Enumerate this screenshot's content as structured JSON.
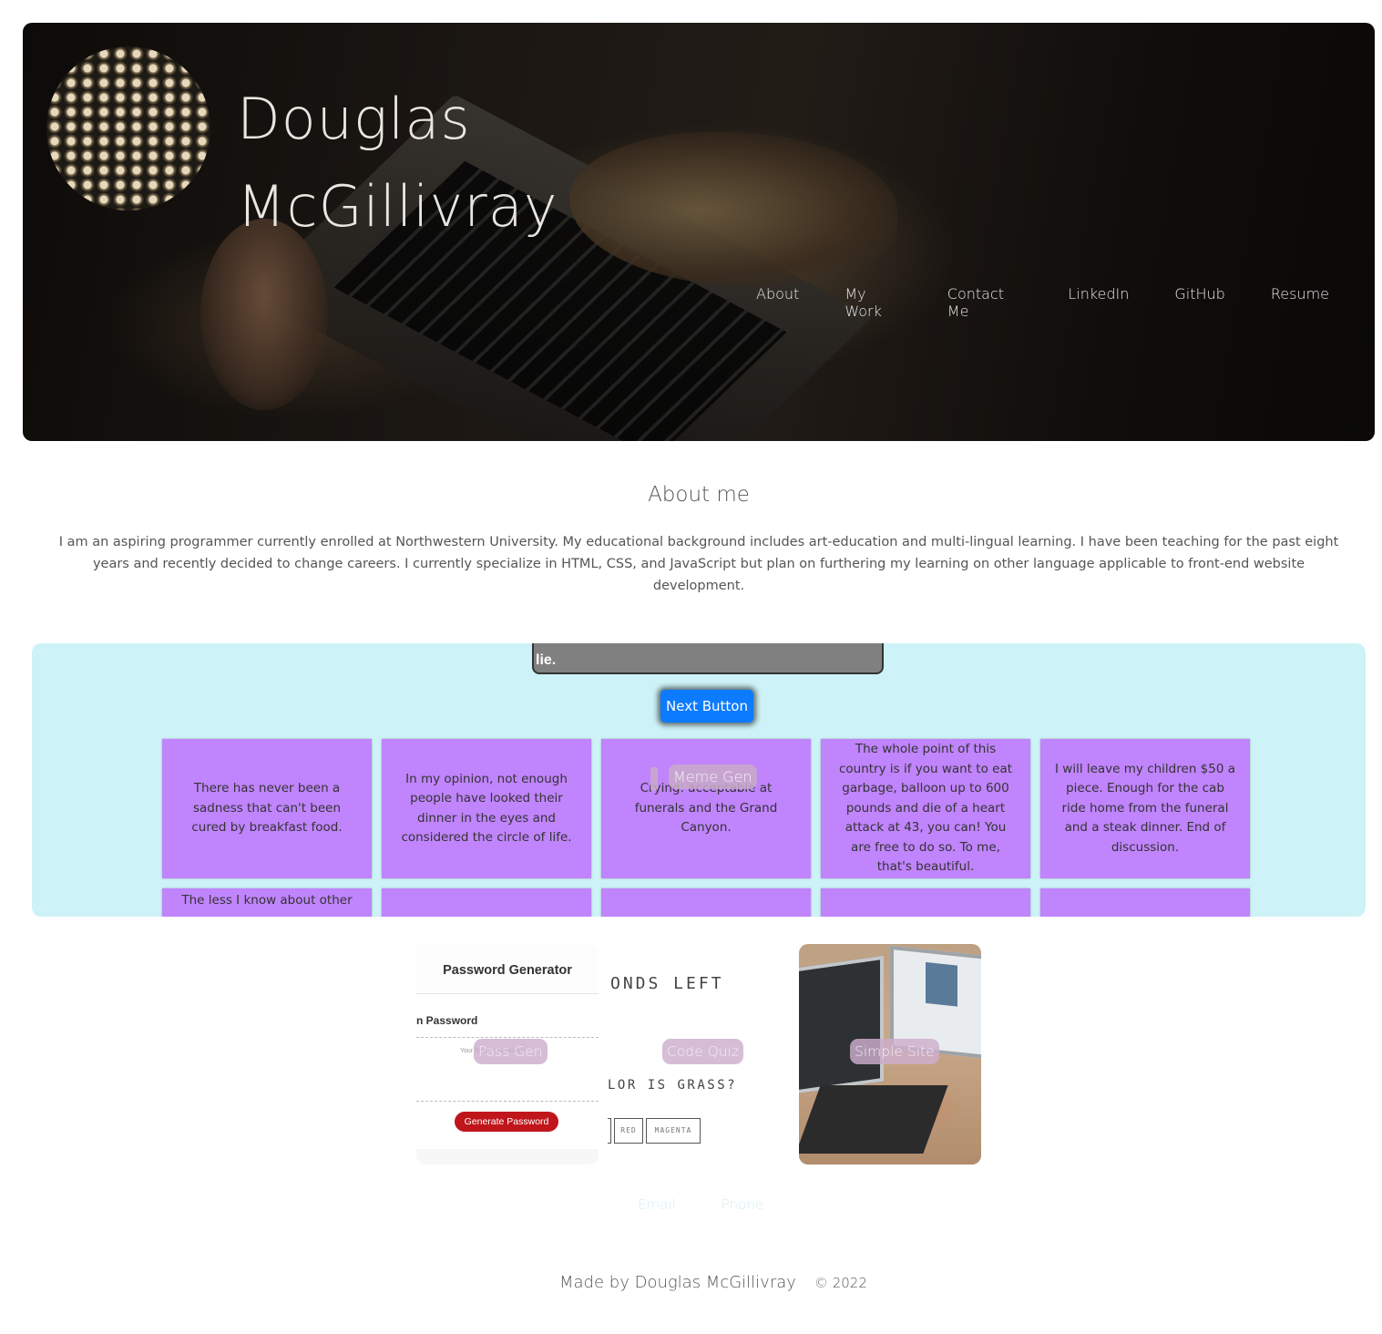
{
  "header": {
    "name_line1": "Douglas",
    "name_line2": "McGillivray",
    "nav": [
      "About",
      "My Work",
      "Contact Me",
      "LinkedIn",
      "GitHub",
      "Resume"
    ]
  },
  "about": {
    "title": "About me",
    "text": "I am an aspiring programmer currently enrolled at Northwestern University. My educational background includes art-education and multi-lingual learning. I have been teaching for the past eight years and recently decided to change careers. I currently specialize in HTML, CSS, and JavaScript but plan on furthering my learning on other language applicable to front-end website development."
  },
  "meme_gen": {
    "quote_fragment": "lie.",
    "next_button": "Next Button",
    "label": "Meme Gen",
    "cards": [
      "There has never been a sadness that can't been cured by breakfast food.",
      "In my opinion, not enough people have looked their dinner in the eyes and considered the circle of life.",
      "Crying: acceptable at funerals and the Grand Canyon.",
      "The whole point of this country is if you want to eat garbage, balloon up to 600 pounds and die of a heart attack at 43, you can! You are free to do so. To me, that's beautiful.",
      "I will leave my children $50 a piece. Enough for the cab ride home from the funeral and a steak dinner. End of discussion.",
      "The less I know about other",
      "",
      "",
      "",
      ""
    ]
  },
  "projects": {
    "pass_gen": {
      "label": "Pass Gen",
      "title": "Password Generator",
      "subtitle": "n Password",
      "placeholder": "Your Secure Password",
      "button": "Generate Password"
    },
    "code_quiz": {
      "label": "Code Quiz",
      "timer_text": "ONDS LEFT",
      "question": "LOR IS GRASS?",
      "options": [
        "",
        "RED",
        "MAGENTA"
      ]
    },
    "simple_site": {
      "label": "Simple Site"
    }
  },
  "contact": {
    "email": "Email",
    "phone": "Phone"
  },
  "footer": {
    "made_by": "Made by Douglas McGillivray",
    "copyright": "© 2022"
  }
}
